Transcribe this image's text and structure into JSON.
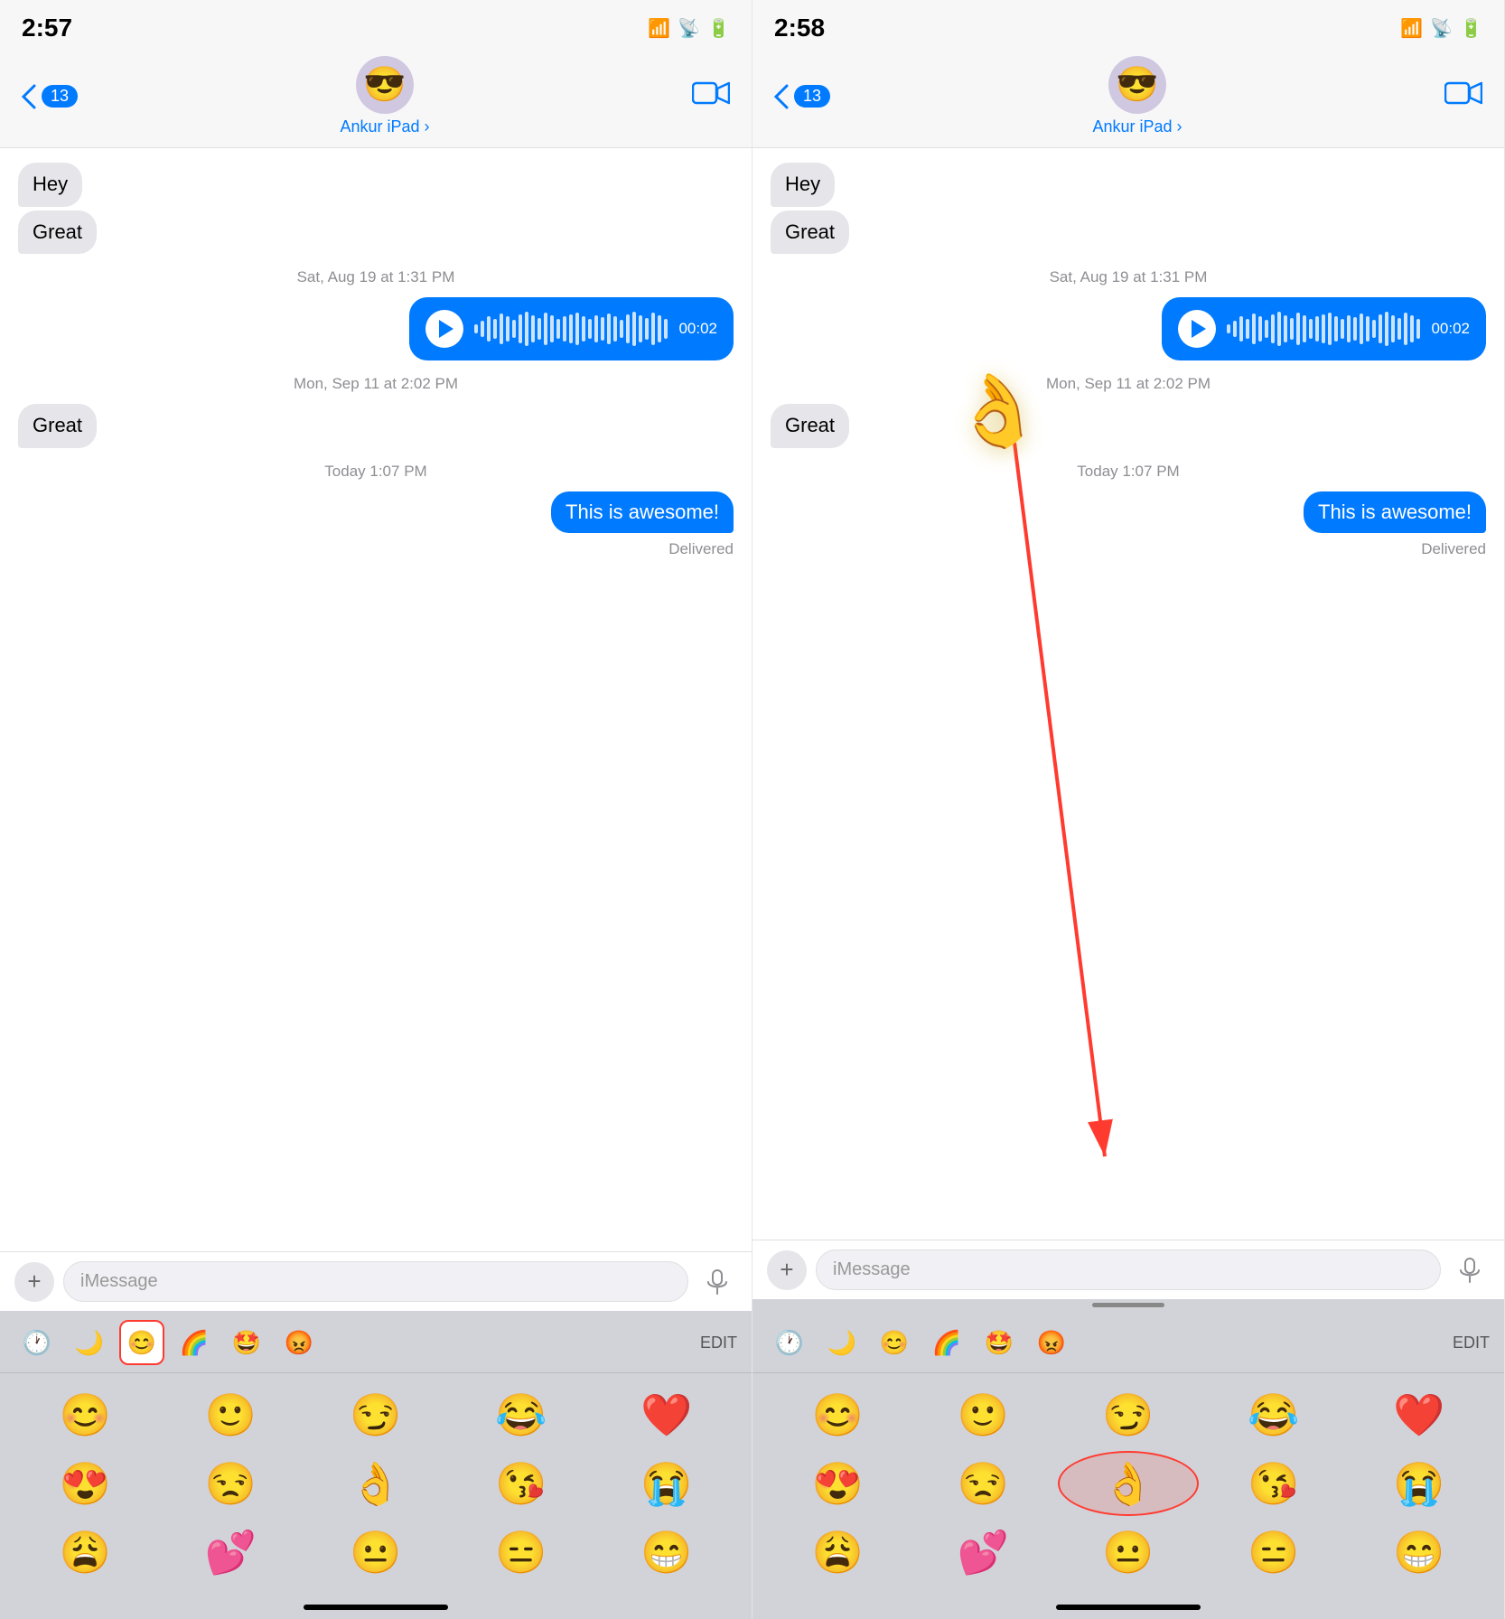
{
  "left_panel": {
    "status_time": "2:57",
    "contact_name": "Ankur iPad",
    "back_count": "13",
    "contact_emoji": "😎",
    "messages": [
      {
        "type": "received",
        "text": "Hey"
      },
      {
        "type": "received",
        "text": "Great"
      },
      {
        "type": "timestamp",
        "text": "Sat, Aug 19 at 1:31 PM"
      },
      {
        "type": "audio",
        "duration": "00:02"
      },
      {
        "type": "timestamp",
        "text": "Mon, Sep 11 at 2:02 PM"
      },
      {
        "type": "received",
        "text": "Great"
      },
      {
        "type": "timestamp",
        "text": "Today 1:07 PM"
      },
      {
        "type": "sent",
        "text": "This is awesome!"
      },
      {
        "type": "delivered",
        "text": "Delivered"
      }
    ],
    "input_placeholder": "iMessage",
    "emoji_tabs": [
      "🕐",
      "🌙",
      "😊",
      "🌈",
      "🤩",
      "😡"
    ],
    "emoji_active_tab": 2,
    "emoji_edit": "EDIT",
    "emoji_grid": [
      "😊",
      "😊",
      "😏",
      "😂",
      "❤️",
      "😍",
      "😒",
      "👌",
      "😘",
      "😭",
      "😩",
      "💕",
      "😐",
      "😑",
      "😁"
    ]
  },
  "right_panel": {
    "status_time": "2:58",
    "contact_name": "Ankur iPad",
    "back_count": "13",
    "contact_emoji": "😎",
    "messages": [
      {
        "type": "received",
        "text": "Hey"
      },
      {
        "type": "received",
        "text": "Great"
      },
      {
        "type": "timestamp",
        "text": "Sat, Aug 19 at 1:31 PM"
      },
      {
        "type": "audio",
        "duration": "00:02"
      },
      {
        "type": "timestamp",
        "text": "Mon, Sep 11 at 2:02 PM"
      },
      {
        "type": "received",
        "text": "Great"
      },
      {
        "type": "timestamp",
        "text": "Today 1:07 PM"
      },
      {
        "type": "sent",
        "text": "This is awesome!"
      },
      {
        "type": "delivered",
        "text": "Delivered"
      }
    ],
    "input_placeholder": "iMessage",
    "emoji_tabs": [
      "🕐",
      "🌙",
      "😊",
      "🌈",
      "🤩",
      "😡"
    ],
    "emoji_active_tab": 2,
    "emoji_edit": "EDIT",
    "emoji_grid": [
      "😊",
      "😊",
      "😏",
      "😂",
      "❤️",
      "😍",
      "😒",
      "👌",
      "😘",
      "😭",
      "😩",
      "💕",
      "😐",
      "😑",
      "😁"
    ],
    "floating_ok_emoji": "👌",
    "arrow_color": "#ff3b30"
  },
  "waveform_heights": [
    10,
    18,
    28,
    22,
    34,
    28,
    20,
    32,
    38,
    30,
    24,
    36,
    30,
    22,
    28,
    32,
    36,
    28,
    22,
    30,
    26,
    34,
    28,
    20,
    32,
    38,
    30,
    24,
    36,
    30,
    22
  ]
}
